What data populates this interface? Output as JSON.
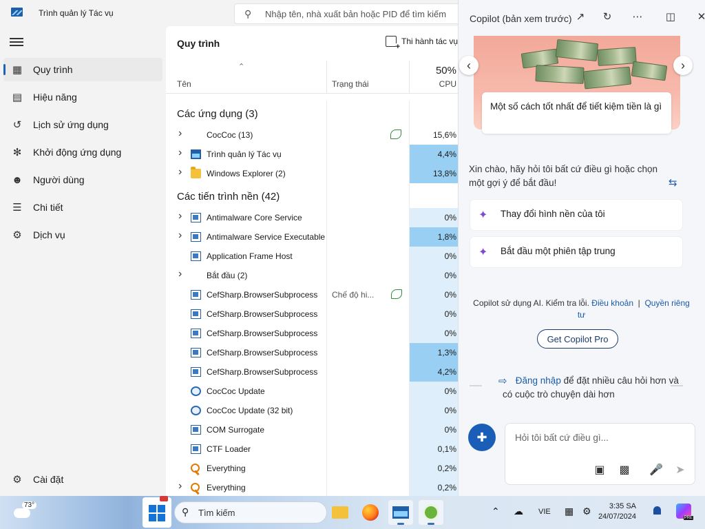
{
  "task_manager": {
    "title": "Trình quản lý Tác vụ",
    "search_placeholder": "Nhập tên, nhà xuất bản hoặc PID để tìm kiếm",
    "nav": {
      "items": [
        {
          "label": "Quy trình",
          "icon": "processes-icon"
        },
        {
          "label": "Hiệu năng",
          "icon": "performance-icon"
        },
        {
          "label": "Lịch sử ứng dụng",
          "icon": "history-icon"
        },
        {
          "label": "Khởi động ứng dụng",
          "icon": "startup-icon"
        },
        {
          "label": "Người dùng",
          "icon": "users-icon"
        },
        {
          "label": "Chi tiết",
          "icon": "details-icon"
        },
        {
          "label": "Dịch vụ",
          "icon": "services-icon"
        }
      ],
      "settings_label": "Cài đặt"
    },
    "page_title": "Quy trình",
    "run_task_label": "Thi hành tác vụ",
    "columns": {
      "name": "Tên",
      "status": "Trạng thái",
      "cpu": "CPU",
      "cpu_total": "50%"
    },
    "groups": {
      "apps": "Các ứng dụng (3)",
      "background": "Các tiến trình nền (42)"
    },
    "apps": [
      {
        "name": "CocCoc (13)",
        "cpu": "15,6%",
        "expandable": true,
        "icon": "coccoc-icon",
        "status": "",
        "efficiency": true
      },
      {
        "name": "Trình quản lý Tác vụ",
        "cpu": "4,4%",
        "expandable": true,
        "icon": "task-manager-icon",
        "status": "",
        "efficiency": false
      },
      {
        "name": "Windows Explorer (2)",
        "cpu": "13,8%",
        "expandable": true,
        "icon": "folder-icon",
        "status": "",
        "efficiency": false
      }
    ],
    "background": [
      {
        "name": "Antimalware Core Service",
        "cpu": "0%",
        "expandable": true,
        "icon": "window-icon",
        "status": ""
      },
      {
        "name": "Antimalware Service Executable",
        "cpu": "1,8%",
        "expandable": true,
        "icon": "window-icon",
        "status": ""
      },
      {
        "name": "Application Frame Host",
        "cpu": "0%",
        "expandable": false,
        "icon": "window-icon",
        "status": ""
      },
      {
        "name": "Bắt đầu (2)",
        "cpu": "0%",
        "expandable": true,
        "icon": "",
        "status": ""
      },
      {
        "name": "CefSharp.BrowserSubprocess",
        "cpu": "0%",
        "expandable": false,
        "icon": "window-icon",
        "status": "Chế độ hi...",
        "efficiency": true
      },
      {
        "name": "CefSharp.BrowserSubprocess",
        "cpu": "0%",
        "expandable": false,
        "icon": "window-icon",
        "status": ""
      },
      {
        "name": "CefSharp.BrowserSubprocess",
        "cpu": "0%",
        "expandable": false,
        "icon": "window-icon",
        "status": ""
      },
      {
        "name": "CefSharp.BrowserSubprocess",
        "cpu": "1,3%",
        "expandable": false,
        "icon": "window-icon",
        "status": ""
      },
      {
        "name": "CefSharp.BrowserSubprocess",
        "cpu": "4,2%",
        "expandable": false,
        "icon": "window-icon",
        "status": ""
      },
      {
        "name": "CocCoc Update",
        "cpu": "0%",
        "expandable": false,
        "icon": "update-icon",
        "status": ""
      },
      {
        "name": "CocCoc Update (32 bit)",
        "cpu": "0%",
        "expandable": false,
        "icon": "update-icon",
        "status": ""
      },
      {
        "name": "COM Surrogate",
        "cpu": "0%",
        "expandable": false,
        "icon": "window-icon",
        "status": ""
      },
      {
        "name": "CTF Loader",
        "cpu": "0,1%",
        "expandable": false,
        "icon": "window-icon",
        "status": ""
      },
      {
        "name": "Everything",
        "cpu": "0,2%",
        "expandable": false,
        "icon": "key-icon",
        "status": ""
      },
      {
        "name": "Everything",
        "cpu": "0,2%",
        "expandable": true,
        "icon": "key-icon",
        "status": ""
      }
    ],
    "cpu_heat": {
      "low": "#deeefa",
      "high": "#99cff3",
      "threshold_pct": 1.0,
      "none": "#ffffff"
    }
  },
  "copilot": {
    "title": "Copilot (bản xem trước)",
    "carousel_caption": "Một số cách tốt nhất để tiết kiệm tiền là gì",
    "greeting": "Xin chào, hãy hỏi tôi bất cứ điều gì hoặc chọn một gợi ý để bắt đầu!",
    "suggestions": [
      "Thay đổi hình nền của tôi",
      "Bắt đầu một phiên tập trung"
    ],
    "disclaimer_prefix": "Copilot sử dụng AI. Kiểm tra lỗi.",
    "terms_link": "Điều khoản",
    "privacy_link": "Quyền riêng tư",
    "pro_button": "Get Copilot Pro",
    "signin_link": "Đăng nhập",
    "signin_rest": "để đặt nhiều câu hỏi hơn và có cuộc trò chuyện dài hơn",
    "chat_placeholder": "Hỏi tôi bất cứ điều gì..."
  },
  "taskbar": {
    "weather_temp": "73°",
    "search_label": "Tìm kiếm",
    "language": "VIE",
    "time": "3:35 SA",
    "date": "24/07/2024",
    "preview_badge": "PRE"
  },
  "colors": {
    "accent": "#1a63b8",
    "link": "#1a5aa8",
    "copilot_button": "#1a5eb8"
  }
}
